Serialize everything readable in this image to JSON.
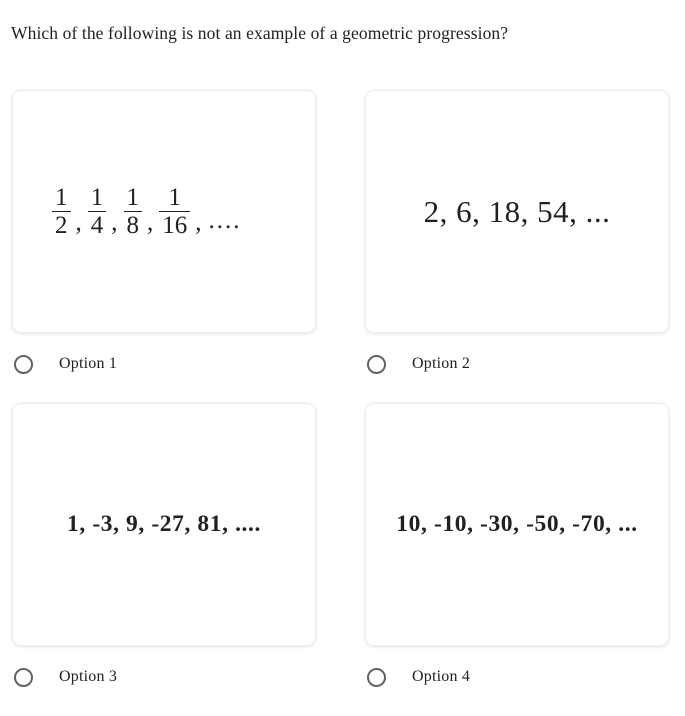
{
  "question": {
    "text": "Which of the following is not an example of a geometric progression?"
  },
  "options": [
    {
      "id": "option-1",
      "label": "Option 1",
      "content_type": "fractions",
      "fractions": [
        {
          "numerator": "1",
          "denominator": "2"
        },
        {
          "numerator": "1",
          "denominator": "4"
        },
        {
          "numerator": "1",
          "denominator": "8"
        },
        {
          "numerator": "1",
          "denominator": "16"
        }
      ],
      "separator": ",",
      "trailing": "....",
      "selected": false
    },
    {
      "id": "option-2",
      "label": "Option 2",
      "content_type": "text",
      "sequence": "2, 6, 18, 54, ...",
      "selected": false
    },
    {
      "id": "option-3",
      "label": "Option 3",
      "content_type": "text",
      "sequence": "1, -3, 9, -27, 81, ....",
      "selected": false
    },
    {
      "id": "option-4",
      "label": "Option 4",
      "content_type": "text",
      "sequence": "10, -10, -30, -50, -70, ...",
      "selected": false
    }
  ],
  "colors": {
    "text": "#202124",
    "card_border": "#eceff1",
    "radio_stroke": "#5f6368",
    "background": "#ffffff"
  }
}
